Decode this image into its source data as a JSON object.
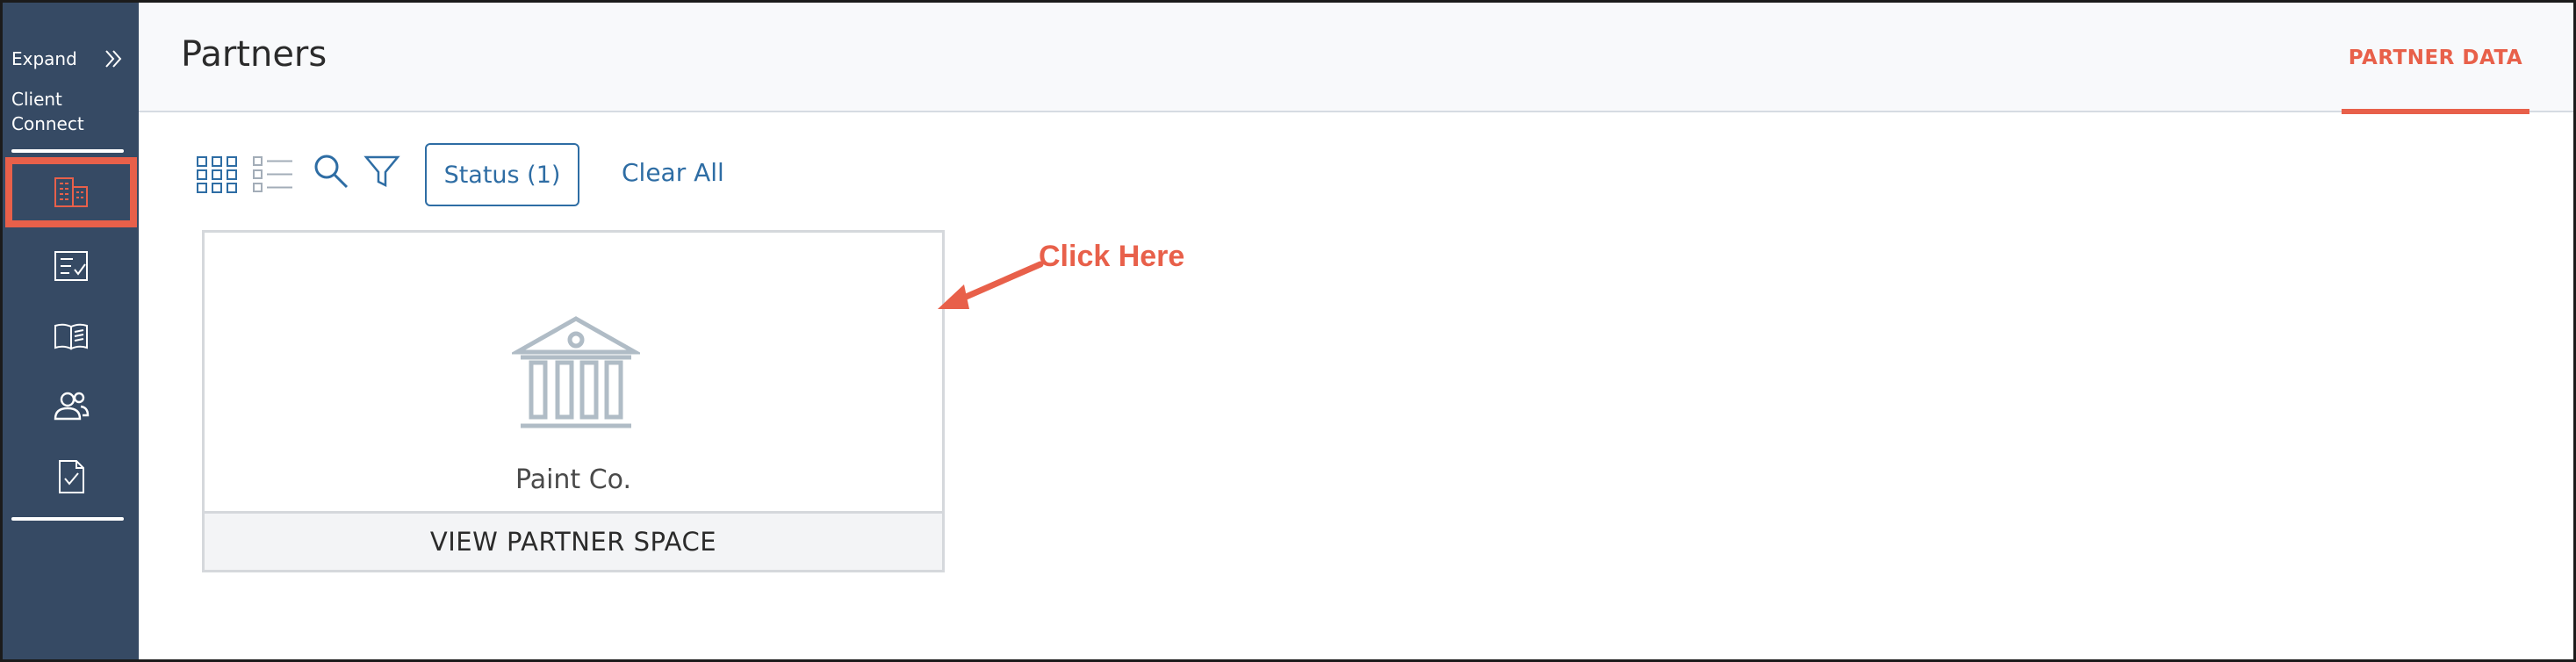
{
  "sidebar": {
    "expand_label": "Expand",
    "client_connect_label": "Client Connect",
    "items": [
      {
        "icon": "building-icon",
        "active": true
      },
      {
        "icon": "checklist-icon",
        "active": false
      },
      {
        "icon": "book-icon",
        "active": false
      },
      {
        "icon": "users-icon",
        "active": false
      },
      {
        "icon": "document-check-icon",
        "active": false
      }
    ]
  },
  "header": {
    "title": "Partners",
    "tab_label": "PARTNER DATA"
  },
  "toolbar": {
    "status_button": "Status (1)",
    "clear_all": "Clear All"
  },
  "partners": [
    {
      "name": "Paint Co.",
      "action": "VIEW PARTNER SPACE"
    }
  ],
  "annotation": {
    "text": "Click Here"
  },
  "colors": {
    "sidebar_bg": "#364a64",
    "accent": "#e8604a",
    "link": "#2e6da4",
    "icon_muted": "#b0bcc6"
  }
}
